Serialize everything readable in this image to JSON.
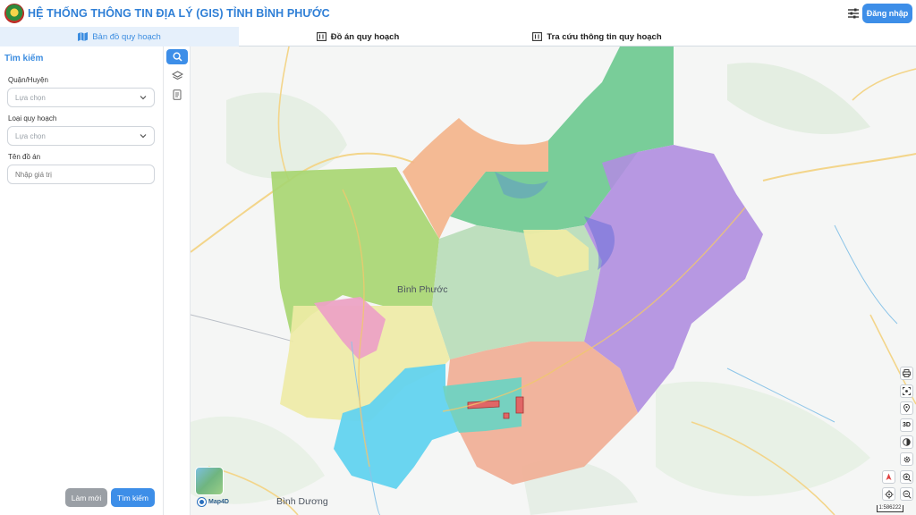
{
  "header": {
    "title": "HỆ THỐNG THÔNG TIN ĐỊA LÝ (GIS) TỈNH BÌNH PHƯỚC",
    "login_label": "Đăng nhập"
  },
  "tabs": [
    {
      "label": "Bản đồ quy hoạch",
      "icon": "map-icon",
      "active": true
    },
    {
      "label": "Đồ án quy hoạch",
      "icon": "plan-icon",
      "active": false
    },
    {
      "label": "Tra cứu thông tin quy hoạch",
      "icon": "plan-icon",
      "active": false
    }
  ],
  "search_panel": {
    "title": "Tìm kiếm",
    "district_label": "Quận/Huyện",
    "district_value": "Lựa chọn",
    "type_label": "Loại quy hoạch",
    "type_value": "Lựa chọn",
    "name_label": "Tên đồ án",
    "name_placeholder": "Nhập giá trị",
    "reset_label": "Làm mới",
    "search_label": "Tìm kiếm"
  },
  "tool_strip": [
    "search-icon",
    "layers-icon",
    "document-icon"
  ],
  "map": {
    "places": [
      "Bình Phước",
      "Bình Dương"
    ],
    "brand": "Map4D",
    "scale_label": "1:586222",
    "controls": [
      "print-icon",
      "screenshot-icon",
      "location-pin-icon",
      "3D",
      "contrast-icon",
      "gear-icon",
      "compass-icon",
      "zoom-in-icon",
      "locate-icon",
      "zoom-out-icon"
    ],
    "colors": {
      "accent": "#3d8ee8",
      "title": "#2f7fd6",
      "zone_green": "#6cc98f",
      "zone_orange": "#f3b48b",
      "zone_lime": "#a8d672",
      "zone_purple": "#b08ee0",
      "zone_teal": "#6fd3c2",
      "zone_yellow": "#eeeba5",
      "zone_pink": "#eca3c5",
      "zone_cyan": "#62d3ef",
      "zone_salmon": "#f1ad93",
      "zone_sage": "#b8dcb8"
    }
  }
}
